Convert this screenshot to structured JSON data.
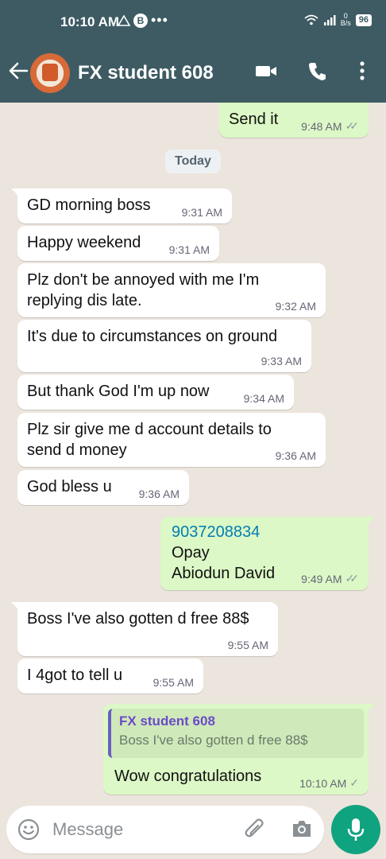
{
  "status_bar": {
    "time": "10:10 AM",
    "battery": "96",
    "net_speed_top": "0",
    "net_speed_unit": "B/s"
  },
  "header": {
    "contact_name": "FX student 608"
  },
  "chat": {
    "day_chip": "Today",
    "messages": [
      {
        "dir": "out",
        "text": "Send it",
        "time": "9:48 AM",
        "status": "read"
      },
      {
        "dir": "in",
        "text": "GD morning boss",
        "time": "9:31 AM"
      },
      {
        "dir": "in",
        "text": "Happy weekend",
        "time": "9:31 AM"
      },
      {
        "dir": "in",
        "line1": "Plz don't be annoyed with me I'm",
        "line2": "replying dis late.",
        "time": "9:32 AM"
      },
      {
        "dir": "in",
        "text": "It's due to circumstances on ground",
        "time": "9:33 AM"
      },
      {
        "dir": "in",
        "text": "But thank God I'm up now",
        "time": "9:34 AM"
      },
      {
        "dir": "in",
        "line1": "Plz sir give me d account details to",
        "line2": "send d money",
        "time": "9:36 AM"
      },
      {
        "dir": "in",
        "text": "God bless u",
        "time": "9:36 AM"
      },
      {
        "dir": "out",
        "phone": "9037208834",
        "line2": "Opay",
        "line3": "Abiodun David",
        "time": "9:49 AM",
        "status": "read"
      },
      {
        "dir": "in",
        "text": "Boss I've also gotten d free 88$",
        "time": "9:55 AM"
      },
      {
        "dir": "in",
        "text": "I 4got to tell u",
        "time": "9:55 AM"
      },
      {
        "dir": "out",
        "quote_name": "FX student 608",
        "quote_text": "Boss I've also gotten d free 88$",
        "text": "Wow congratulations",
        "time": "10:10 AM",
        "status": "sent"
      }
    ]
  },
  "input": {
    "placeholder": "Message"
  },
  "colors": {
    "header": "#3e5b63",
    "incoming": "#ffffff",
    "outgoing": "#dcf8c6",
    "mic": "#10a37f",
    "link": "#027eb5"
  }
}
